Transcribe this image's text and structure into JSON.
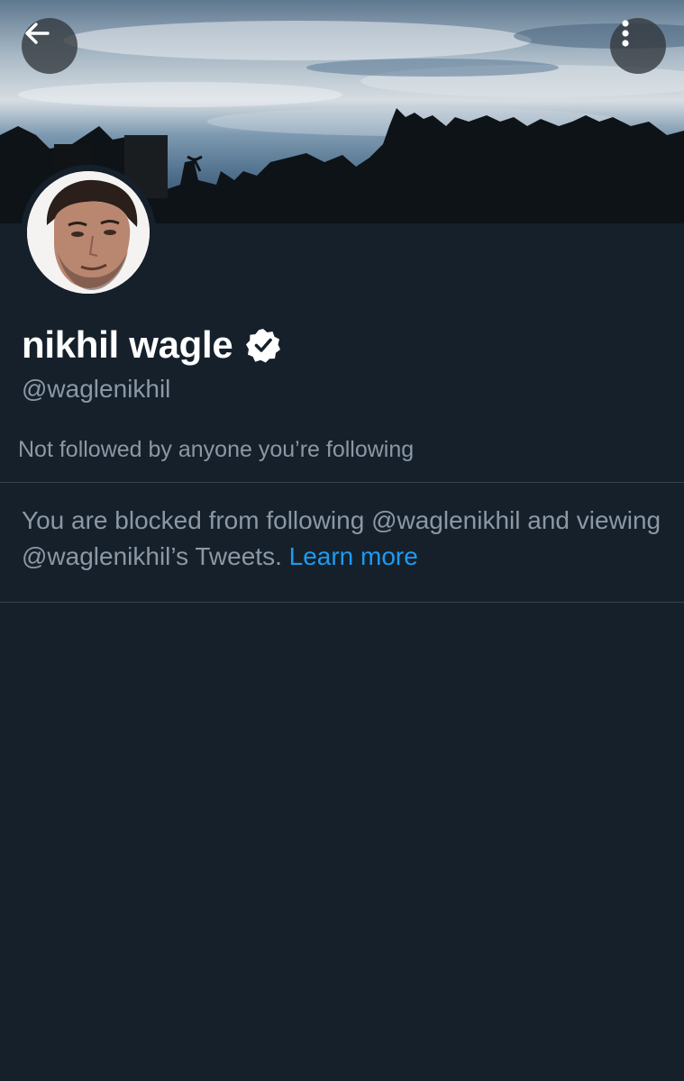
{
  "header": {
    "back_icon": "arrow-left-icon",
    "more_icon": "vertical-dots-icon"
  },
  "profile": {
    "display_name": "nikhil wagle",
    "verified_icon": "verified-badge-icon",
    "handle": "@waglenikhil",
    "followers_note": "Not followed by anyone you’re following"
  },
  "blocked": {
    "message": "You are blocked from following @waglenikhil and viewing @waglenikhil’s Tweets.",
    "learn_more": "Learn more"
  },
  "colors": {
    "background": "#15202b",
    "secondary_text": "#8b98a5",
    "link": "#1d9bf0",
    "divider": "#38444d"
  }
}
